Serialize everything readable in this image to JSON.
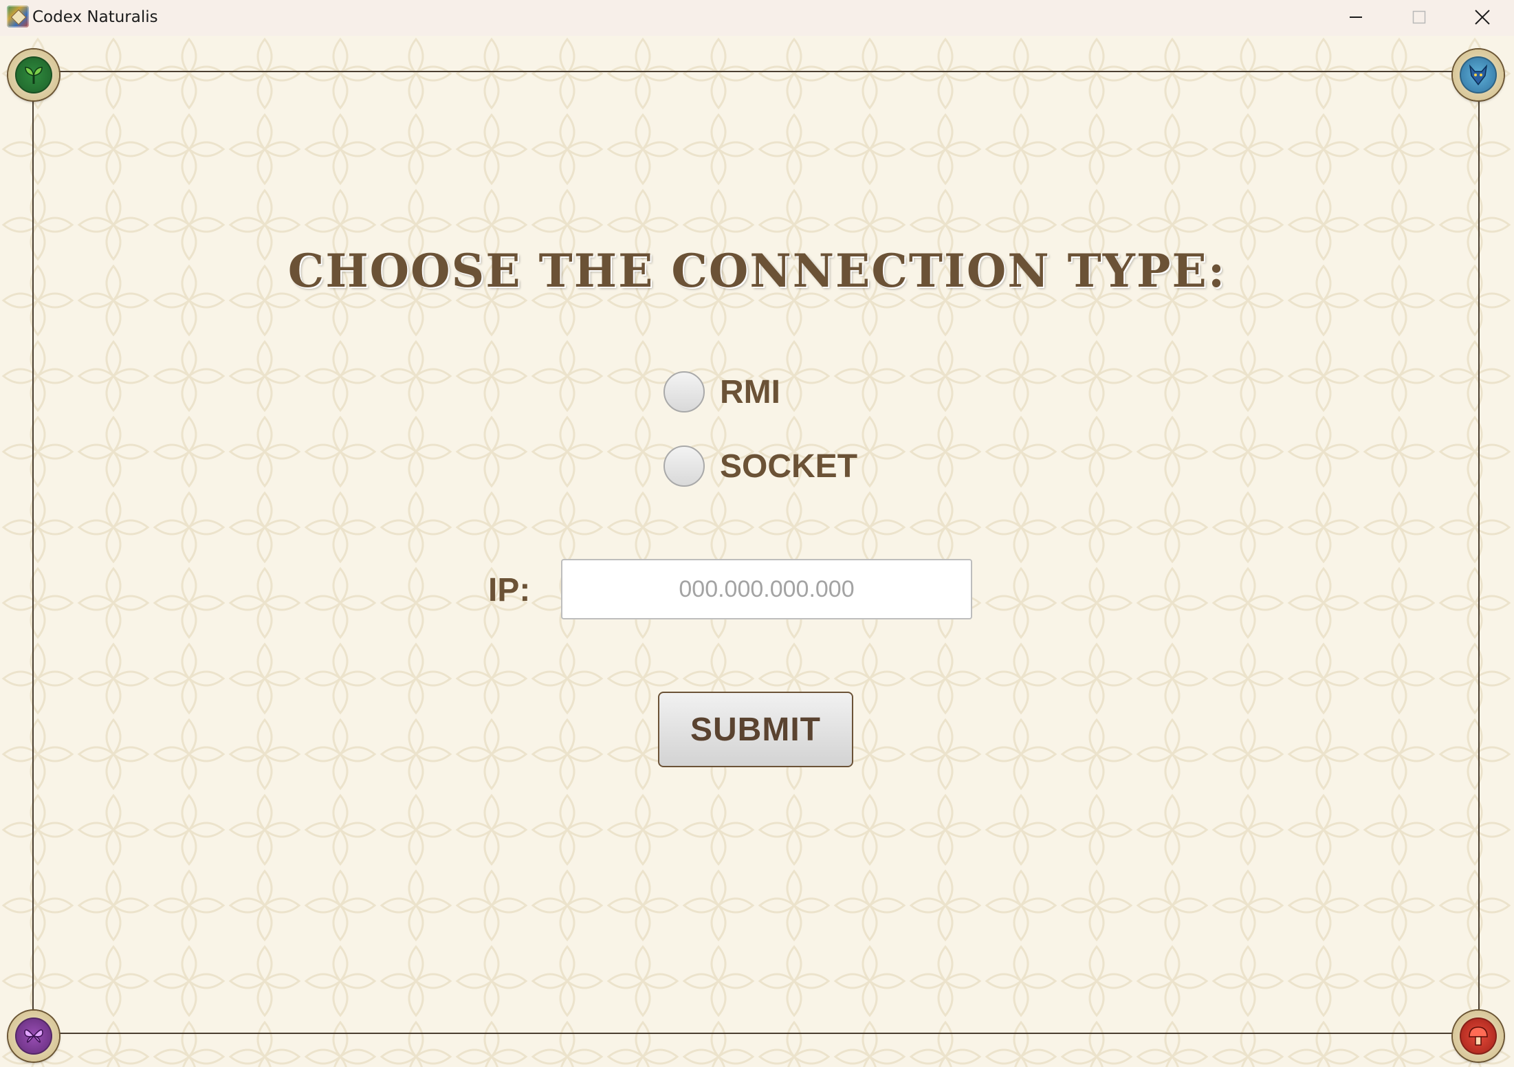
{
  "window": {
    "title": "Codex Naturalis",
    "app_icon": "codex-app-icon",
    "controls": [
      "minimize-icon",
      "maximize-icon",
      "close-icon"
    ]
  },
  "corners": {
    "top_left": "plant-leaf-icon",
    "top_right": "wolf-animal-icon",
    "bottom_left": "butterfly-insect-icon",
    "bottom_right": "mushroom-fungi-icon"
  },
  "form": {
    "heading": "Choose the connection type:",
    "options": [
      {
        "label": "RMI",
        "selected": false
      },
      {
        "label": "SOCKET",
        "selected": false
      }
    ],
    "ip_label": "IP:",
    "ip_value": "",
    "ip_placeholder": "000.000.000.000",
    "submit_label": "SUBMIT"
  },
  "colors": {
    "background": "#f9f4e7",
    "accent_brown": "#6b5236",
    "frame": "#4a3e30"
  }
}
